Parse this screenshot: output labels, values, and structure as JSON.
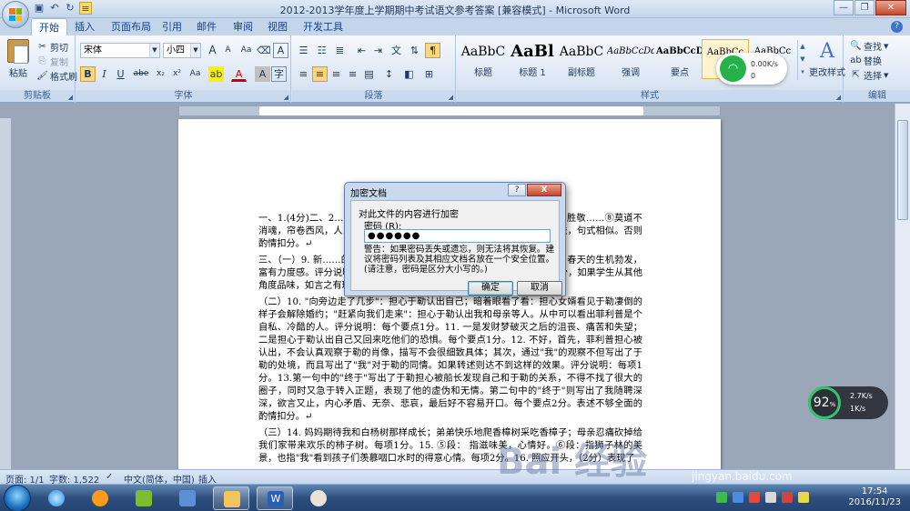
{
  "window": {
    "title": "2012-2013学年度上学期期中考试语文参考答案 [兼容模式] - Microsoft Word",
    "controls": [
      "—",
      "❐",
      "✕"
    ]
  },
  "qat": {
    "icons": [
      "save-icon",
      "undo-icon",
      "redo-icon",
      "format-icon"
    ]
  },
  "tabs": [
    "开始",
    "插入",
    "页面布局",
    "引用",
    "邮件",
    "审阅",
    "视图",
    "开发工具"
  ],
  "ribbon": {
    "clipboard": {
      "label": "剪贴板",
      "paste": "粘贴",
      "cut": "剪切",
      "copy": "复制",
      "format_painter": "格式刷"
    },
    "font": {
      "label": "字体",
      "font_name": "宋体",
      "font_size": "小四",
      "bold": "B",
      "italic": "I",
      "underline": "U",
      "strike": "abe",
      "sub": "x₂",
      "sup": "x²",
      "aa": "Aa",
      "grow": "A",
      "shrink": "A"
    },
    "paragraph": {
      "label": "段落"
    },
    "styles": {
      "label": "样式",
      "items": [
        {
          "preview": "AaBbC",
          "name": "标题"
        },
        {
          "preview": "AaBl",
          "name": "标题 1"
        },
        {
          "preview": "AaBbC",
          "name": "副标题"
        },
        {
          "preview": "AaBbCcDd",
          "name": "强调"
        },
        {
          "preview": "AaBbCcD",
          "name": "要点"
        },
        {
          "preview": "AaBbCc",
          "name": ""
        },
        {
          "preview": "AaBbCc",
          "name": ""
        }
      ],
      "change_styles": "更改样式"
    },
    "editing": {
      "label": "编辑",
      "find": "查找",
      "replace": "替换",
      "select": "选择"
    }
  },
  "network": {
    "up": "0.00K/s",
    "down": "0"
  },
  "document": {
    "paragraphs": [
      "一、1.(4分)二、2……，3……迅 莫言 ③晁盖 史进 每小题1分，错一……胜敬……⑧莫道不消魂，帘卷西风，人比……示例：雪——我是雨水的灵魂，是天使……手法，句式相似。否则酌情扣分。↵",
      "三、（一）9. 新……的喜悦，对乡村生活的深情，同时以虫……透：突出了春天的生机勃发，富有力度感。评分说明：学生答案不够深刻或者不全面可以酌情扣0.5—2分，如果学生从其他角度品味，如言之有理也可得分。↵",
      "（二）10. \"向旁边走了几步\"：担心于勒认出自己；暗着眼看了看：担心女婿看见于勒凄倒的样子会解除婚约；\"赶紧向我们走来\"：担心于勒认出我和母亲等人。从中可以看出菲利普是个自私、冷酷的人。评分说明：每个要点1分。11. 一是发财梦破灭之后的沮丧、痛苦和失望；二是担心于勒认出自己又回来吃他们的恐惧。每个要点1分。12. 不好，首先，菲利普担心被认出，不会认真观察于勒的肖像，描写不会很细致具体；其次，通过\"我\"的观察不但写出了于勒的处境，而且写出了\"我\"对于勒的同情。如果转述则达不到这样的效果。评分说明：每项1分。13.第一句中的\"终于\"写出了于勒担心被船长发现自己和于勒的关系，不得不找了很大的圈子，同时又急于转入正题，表现了他的虚伪和无情。第二句中的\"终于\"则写出了我随聘深深，欲言又止，内心矛盾、无奈、悲哀，最后好不容易开口。每个要点2分。表述不够全面的酌情扣分。↵",
      "（三）14. 妈妈期待我和白杨树那样成长；弟弟快乐地爬香樟树采吃香樟子；母亲忍痛砍掉给我们家带来欢乐的柿子树。每项1分。15. ⑤段： 指滋味美，心情好。⑥段：指狮子林的美景，也指\"我\"看到孩子们羡慕咽口水时的得意心情。每项2分。16. 照应开头，（2分）表现了"
    ],
    "watermark": "Bai 经验",
    "watermark_url": "jingyan.baidu.com"
  },
  "dialog": {
    "title": "加密文档",
    "help": "?",
    "close": "X",
    "heading": "对此文件的内容进行加密",
    "password_label": "密码 (R):",
    "password_value": "●●●●●●",
    "warning": "警告：如果密码丢失或遗忘，则无法将其恢复。建议将密码列表及其相应文档名放在一个安全位置。(请注意，密码是区分大小写的。)",
    "ok": "确定",
    "cancel": "取消"
  },
  "speed_widget": {
    "percent": "92",
    "unit": "%",
    "up": "2.7K/s",
    "down": "1K/s"
  },
  "status": {
    "page": "页面: 1/1",
    "words": "字数: 1,522",
    "lang": "中文(简体，中国)",
    "mode": "插入"
  },
  "taskbar": {
    "tasks": [
      "ie-icon",
      "media-player-icon",
      "explorer-icon",
      "network-icon",
      "folder-icon",
      "word-icon",
      "paint-icon"
    ],
    "time": "17:54",
    "date": "2016/11/23"
  },
  "colors": {
    "ribbon": "#dbe6f4",
    "accent": "#15428b",
    "taskbar": "#2d4f7e"
  }
}
